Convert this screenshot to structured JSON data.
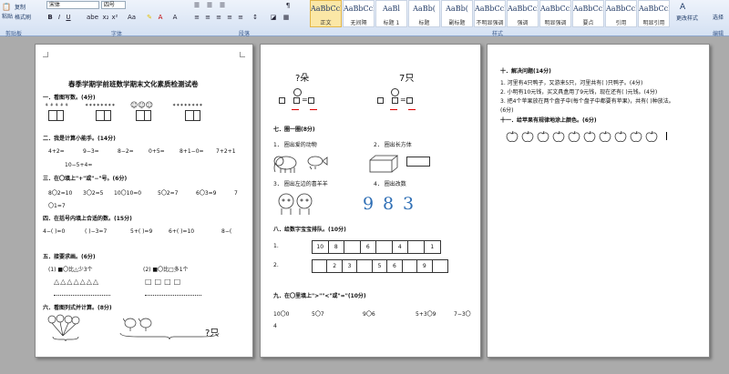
{
  "ribbon": {
    "paste_label": "粘贴",
    "copy_label": "复制",
    "format_painter_label": "格式刷",
    "font_name": "宋体",
    "font_size": "四号",
    "group_clipboard": "剪贴板",
    "group_font": "字体",
    "group_paragraph": "段落",
    "group_styles": "样式",
    "group_editing": "编辑",
    "change_styles": "更改样式",
    "select_label": "选择",
    "styles": [
      {
        "sample": "AaBbCcDc",
        "name": "正文"
      },
      {
        "sample": "AaBbCcDc",
        "name": "无间隔"
      },
      {
        "sample": "AaBl",
        "name": "标题 1"
      },
      {
        "sample": "AaBb(",
        "name": "标题"
      },
      {
        "sample": "AaBb(",
        "name": "副标题"
      },
      {
        "sample": "AaBbCcDt",
        "name": "不明显强调"
      },
      {
        "sample": "AaBbCcDt",
        "name": "强调"
      },
      {
        "sample": "AaBbCcDt",
        "name": "明显强调"
      },
      {
        "sample": "AaBbCcDt",
        "name": "要点"
      },
      {
        "sample": "AaBbCcDt",
        "name": "引用"
      },
      {
        "sample": "AaBbCcDc",
        "name": "明显引用"
      }
    ]
  },
  "page1": {
    "title": "春季学期学前班数学期末文化素质检测试卷",
    "s1": "一．看图写数。(4分)",
    "s2": "二．我是计算小能手。(14分)",
    "calc_row1": [
      "4+2=",
      "9−3=",
      "8−2=",
      "0+5=",
      "8+1−0=",
      "7+2+1"
    ],
    "calc_row2": "10−5+4=",
    "s3": "三．在〇填上\"+\"或\"−\"号。(6分)",
    "ops_row": [
      "8〇2=10",
      "3〇2=5",
      "10〇10=0",
      "5〇2=7",
      "6〇3=9",
      "7"
    ],
    "ops_row2": "〇1=7",
    "s4": "四．在括号内填上合适的数。(15分)",
    "fill_row": [
      "4−(  )=0",
      "(  )−3=7",
      "5+(  )=9",
      "6+(  )=10",
      "8−("
    ],
    "s5": "五．接要求画。(6分)",
    "draw_a": "(1) ■〇比△少3个",
    "draw_b": "(2) ■〇比□多1个",
    "s6": "六．看图列式并计算。(8分)",
    "pic_q": "?只"
  },
  "page2": {
    "q_flower": "?朵",
    "q_animals": "7只",
    "s7": "七．圈一圈(8分)",
    "c1": "1．  圈出爱的动物",
    "c2": "2．  圈出长方体",
    "c3": "3．  圈出左边的喜羊羊",
    "c4": "4．  圈出改数",
    "digits": [
      "9",
      "8",
      "3"
    ],
    "s8": "八．给数字宝宝排队。(10分)",
    "row1_label": "1.",
    "row2_label": "2.",
    "row1": [
      "10",
      "8",
      "",
      "6",
      "",
      "4",
      "",
      "1"
    ],
    "row2": [
      "",
      "2",
      "3",
      "",
      "5",
      "6",
      "",
      "9",
      ""
    ],
    "s9": "九．在〇里填上\">\"\"<\"或\"=\"(10分)",
    "cmp_row": [
      "10〇0",
      "5〇7",
      "9〇6",
      "5+3〇9",
      "7−3〇"
    ],
    "cmp_row2": "4"
  },
  "page3": {
    "s10": "十．解决问题(14分)",
    "p1": "1. 河里有4只鸭子，又游来5只，河里共有(    )只鸭子。(4分)",
    "p2": "2. 小明有10元钱，买文具盒用了9元钱，现在还有(    )元钱。(4分)",
    "p3": "3. 把4个苹果放在两个盘子中(每个盘子中都要有苹果)，共有(    )种放法。",
    "p3b": "(6分)",
    "s11": "十一．给苹果有规律地涂上颜色。(6分)"
  }
}
